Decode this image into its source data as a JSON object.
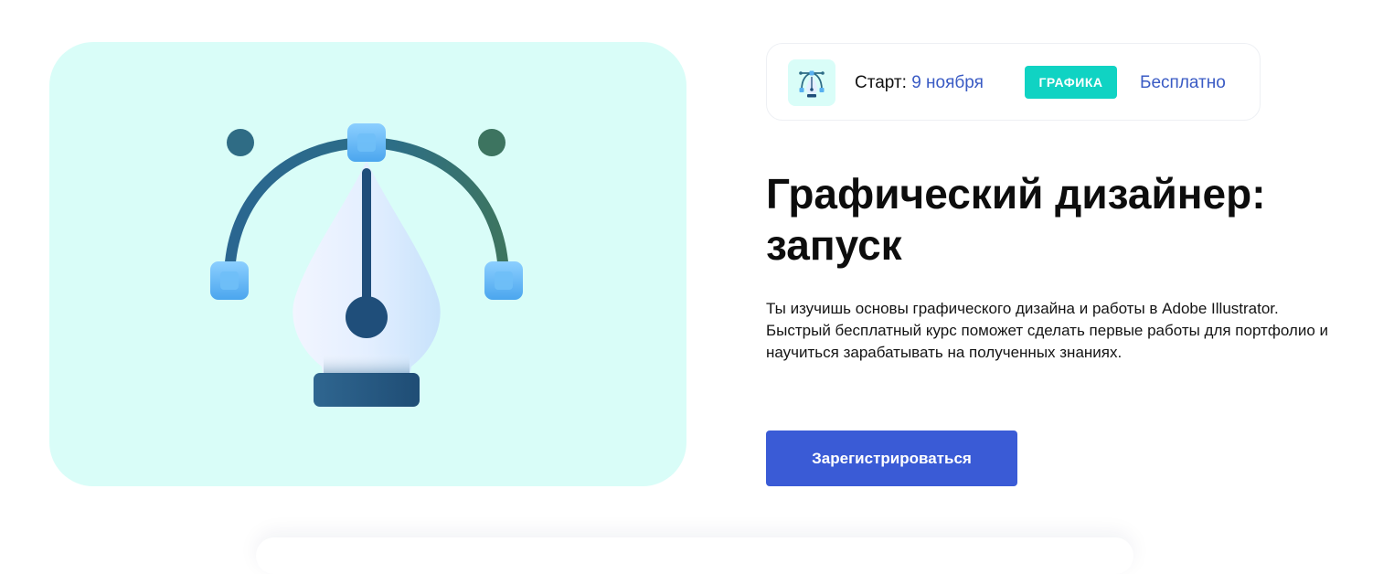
{
  "course": {
    "title": "Графический дизайнер: запуск",
    "description": "Ты изучишь основы графического дизайна и работы в Adobe Illustrator. Быстрый бесплатный курс поможет сделать первые работы для портфолио и научиться зарабатывать на полученных знаниях.",
    "illustration_icon": "pen-tool-icon"
  },
  "info_bar": {
    "start_label": "Старт:",
    "start_date": "9 ноября",
    "category_badge": "ГРАФИКА",
    "price": "Бесплатно",
    "icon": "pen-tool-icon"
  },
  "cta": {
    "register_label": "Зарегистрироваться"
  },
  "colors": {
    "hero_background": "#d9fdf8",
    "accent_blue": "#3a5bd6",
    "link_blue": "#3a5bc4",
    "badge_teal": "#10d3c3"
  }
}
